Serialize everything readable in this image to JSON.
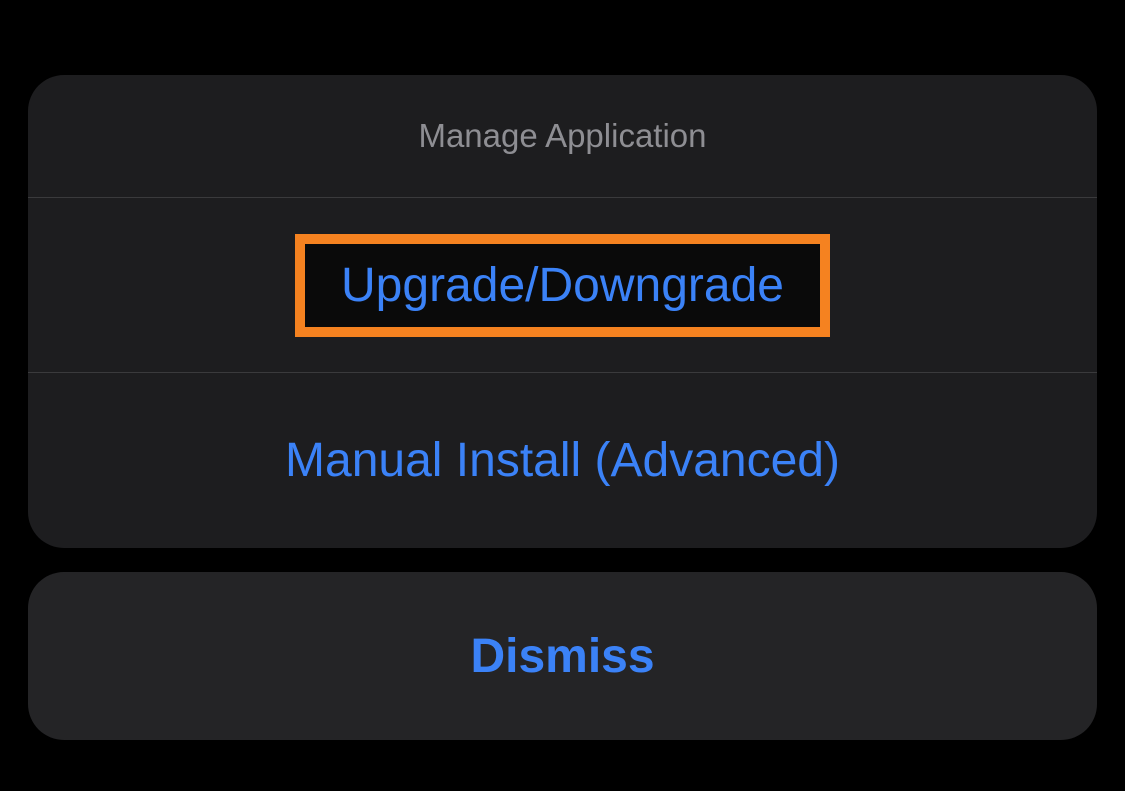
{
  "sheet": {
    "title": "Manage Application",
    "actions": {
      "upgrade": "Upgrade/Downgrade",
      "manual": "Manual Install (Advanced)"
    }
  },
  "dismiss": {
    "label": "Dismiss"
  },
  "colors": {
    "accent": "#3b82f7",
    "highlight": "#f58220",
    "panel": "#1d1d1f",
    "panel2": "#242426",
    "subtitle": "#8e8e93"
  }
}
